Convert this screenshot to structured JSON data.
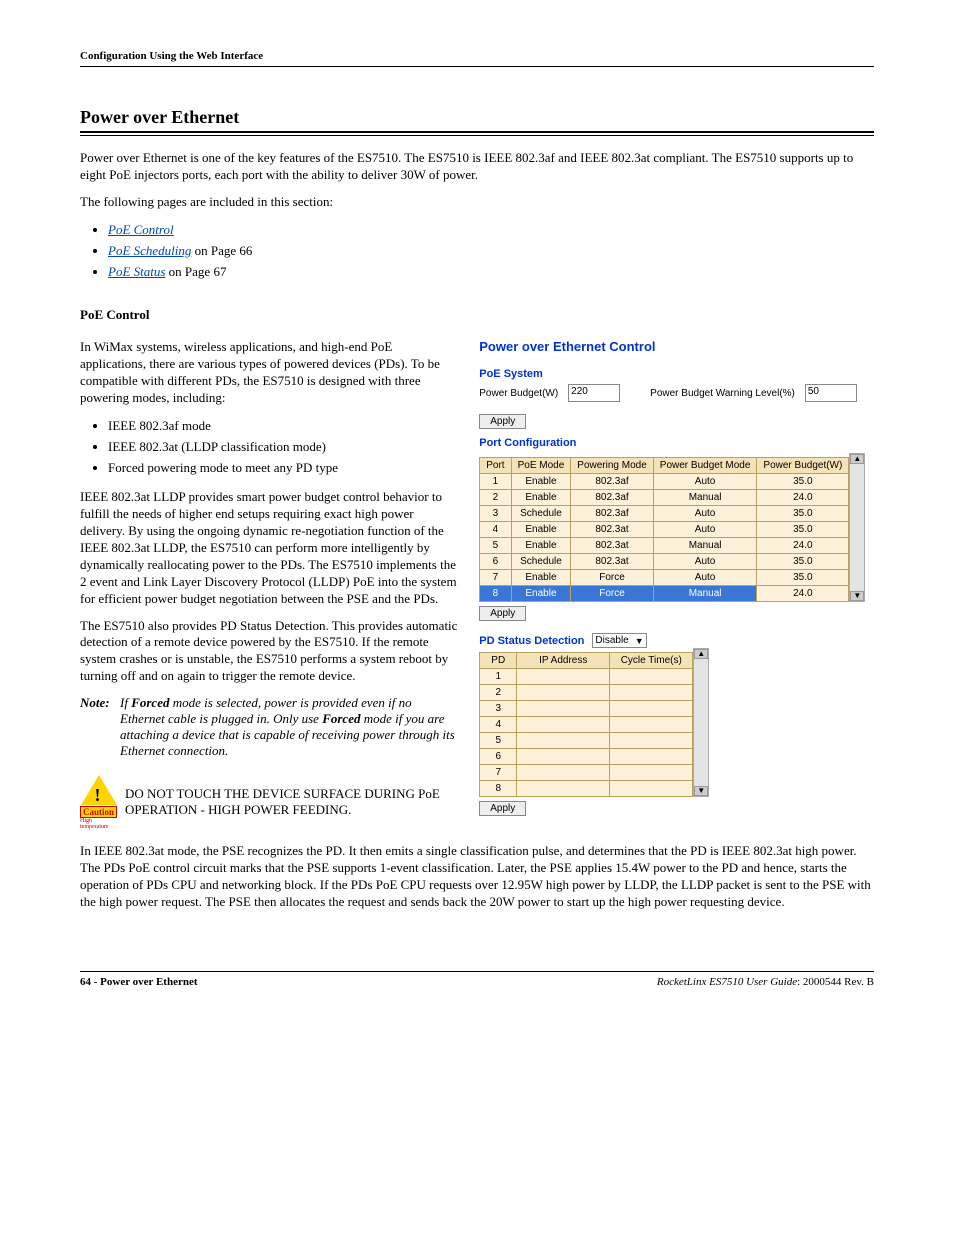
{
  "header": {
    "breadcrumb": "Configuration Using the Web Interface"
  },
  "title": "Power over Ethernet",
  "intro_p1": "Power over Ethernet is one of the key features of the ES7510. The ES7510 is IEEE 802.3af and IEEE 802.3at compliant. The ES7510 supports up to eight PoE injectors ports, each port with the ability to deliver 30W of power.",
  "intro_p2": "The following pages are included in this section:",
  "toc": {
    "items": [
      {
        "link": "PoE Control",
        "suffix": ""
      },
      {
        "link": "PoE Scheduling",
        "suffix": " on Page 66"
      },
      {
        "link": "PoE Status",
        "suffix": " on Page 67"
      }
    ]
  },
  "sub_heading": "PoE Control",
  "left": {
    "p1": "In WiMax systems, wireless applications, and high-end PoE applications, there are various types of powered devices (PDs). To be compatible with different PDs, the ES7510 is designed with three powering modes, including:",
    "modes": [
      "IEEE 802.3af mode",
      "IEEE 802.3at (LLDP classification mode)",
      "Forced powering mode to meet any PD type"
    ],
    "p2": "IEEE 802.3at LLDP provides smart power budget control behavior to fulfill the needs of higher end setups requiring exact high power delivery. By using the ongoing dynamic re-negotiation function of the IEEE 802.3at LLDP, the ES7510 can perform more intelligently by dynamically reallocating power to the PDs. The ES7510 implements the 2 event and Link Layer Discovery Protocol (LLDP) PoE into the system for efficient power budget negotiation between the PSE and the PDs.",
    "p3": "The ES7510 also provides PD Status Detection. This provides automatic detection of a remote device powered by the ES7510. If the remote system crashes or is unstable, the ES7510 performs a system reboot by turning off and on again to trigger the remote device.",
    "note_label": "Note:",
    "note_pre": "If ",
    "note_b1": "Forced",
    "note_mid": " mode is selected, power is provided even if no Ethernet cable is plugged in. Only use ",
    "note_b2": "Forced",
    "note_post": " mode if you are attaching a device that is capable of receiving power through its Ethernet connection.",
    "caution_label": "Caution",
    "caution_sub": "High temperature",
    "caution_text": "DO NOT TOUCH THE DEVICE SURFACE DURING PoE OPERATION - HIGH POWER FEEDING."
  },
  "web": {
    "title": "Power over Ethernet Control",
    "system": {
      "heading": "PoE System",
      "budget_label": "Power Budget(W)",
      "budget_value": "220",
      "warn_label": "Power Budget Warning Level(%)",
      "warn_value": "50"
    },
    "apply_label": "Apply",
    "portconf": {
      "heading": "Port Configuration",
      "headers": [
        "Port",
        "PoE Mode",
        "Powering Mode",
        "Power Budget Mode",
        "Power Budget(W)"
      ],
      "rows": [
        [
          "1",
          "Enable",
          "802.3af",
          "Auto",
          "35.0"
        ],
        [
          "2",
          "Enable",
          "802.3af",
          "Manual",
          "24.0"
        ],
        [
          "3",
          "Schedule",
          "802.3af",
          "Auto",
          "35.0"
        ],
        [
          "4",
          "Enable",
          "802.3at",
          "Auto",
          "35.0"
        ],
        [
          "5",
          "Enable",
          "802.3at",
          "Manual",
          "24.0"
        ],
        [
          "6",
          "Schedule",
          "802.3at",
          "Auto",
          "35.0"
        ],
        [
          "7",
          "Enable",
          "Force",
          "Auto",
          "35.0"
        ],
        [
          "8",
          "Enable",
          "Force",
          "Manual",
          "24.0"
        ]
      ]
    },
    "pd": {
      "heading": "PD Status Detection",
      "select_value": "Disable",
      "headers": [
        "PD",
        "IP Address",
        "Cycle Time(s)"
      ],
      "rows": [
        "1",
        "2",
        "3",
        "4",
        "5",
        "6",
        "7",
        "8"
      ]
    }
  },
  "body_after": "In IEEE 802.3at mode, the PSE recognizes the PD. It then emits a single classification pulse, and determines that the PD is IEEE 802.3at high power. The PDs PoE control circuit marks that the PSE supports 1-event classification. Later, the PSE applies 15.4W power to the PD and hence, starts the operation of PDs CPU and networking block. If the PDs PoE CPU requests over 12.95W high power by LLDP, the LLDP packet is sent to the PSE with the high power request. The PSE then allocates the request and sends back the 20W power to start up the high power requesting device.",
  "footer": {
    "page_no": "64",
    "left_sep": " - ",
    "left_title": "Power over Ethernet",
    "right_product": "RocketLinx ES7510  User Guide",
    "right_sep": ": ",
    "right_rev": "2000544 Rev. B"
  }
}
